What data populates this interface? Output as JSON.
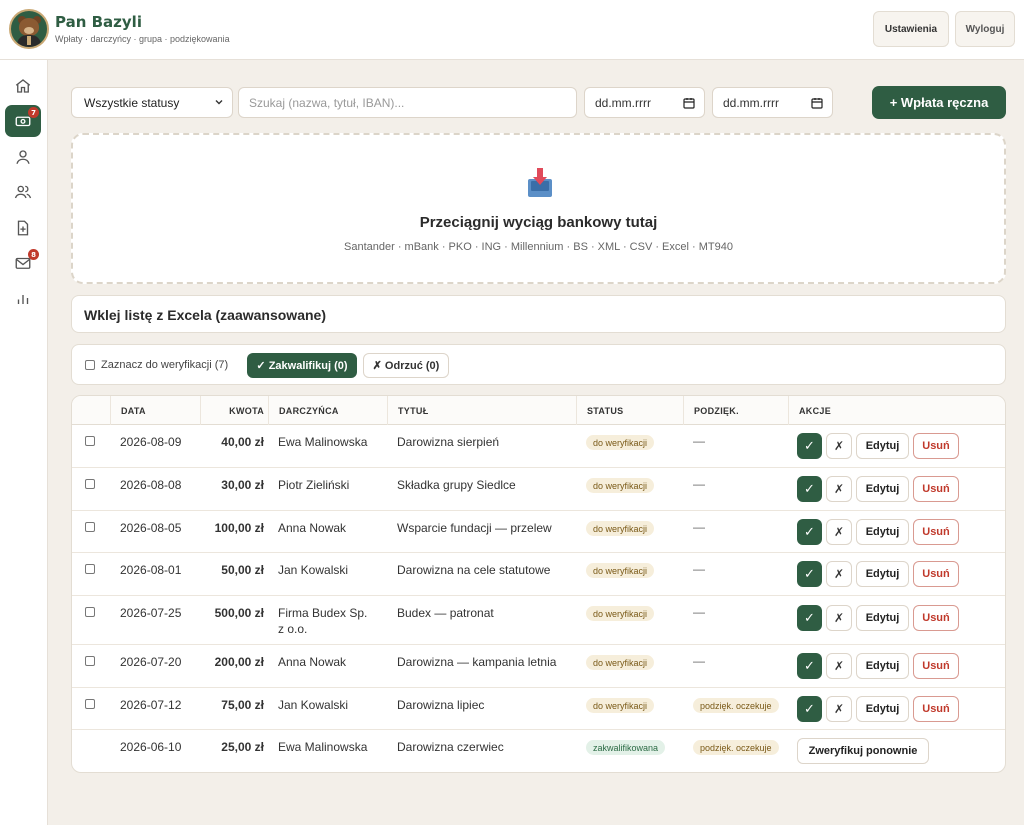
{
  "app": {
    "title": "Pan Bazyli",
    "subtitle": "Wpłaty · darczyńcy · grupa · podziękowania",
    "settings_label": "Ustawienia",
    "logout_label": "Wyloguj"
  },
  "sidebar": {
    "items": [
      {
        "icon": "home-icon",
        "active": false,
        "badge": ""
      },
      {
        "icon": "money-icon",
        "active": true,
        "badge": "7"
      },
      {
        "icon": "user-icon",
        "active": false,
        "badge": ""
      },
      {
        "icon": "users-icon",
        "active": false,
        "badge": ""
      },
      {
        "icon": "file-plus-icon",
        "active": false,
        "badge": ""
      },
      {
        "icon": "mail-icon",
        "active": false,
        "badge": "8"
      },
      {
        "icon": "chart-icon",
        "active": false,
        "badge": ""
      }
    ]
  },
  "filters": {
    "status_value": "Wszystkie statusy",
    "search_placeholder": "Szukaj (nazwa, tytuł, IBAN)...",
    "date_from": "dd.mm.rrrr",
    "date_to": "dd.mm.rrrr",
    "add_label": "+ Wpłata ręczna"
  },
  "dropzone": {
    "title": "Przeciągnij wyciąg bankowy tutaj",
    "formats": "Santander · mBank · PKO · ING · Millennium · BS · XML · CSV · Excel · MT940"
  },
  "paste": {
    "label": "Wklej listę z Excela (zaawansowane)"
  },
  "bulk": {
    "select_label": "Zaznacz do weryfikacji (7)",
    "qualify_label": "✓ Zakwalifikuj (0)",
    "reject_label": "✗ Odrzuć (0)"
  },
  "table": {
    "headers": [
      "DATA",
      "KWOTA",
      "DARCZYŃCA",
      "TYTUŁ",
      "STATUS",
      "PODZIĘK.",
      "AKCJE"
    ],
    "rows": [
      {
        "date": "2026-08-09",
        "amount": "40,00 zł",
        "donor": "Ewa Malinowska",
        "title": "Darowizna sierpień",
        "status": "do weryfikacji",
        "thanks": "—"
      },
      {
        "date": "2026-08-08",
        "amount": "30,00 zł",
        "donor": "Piotr Zieliński",
        "title": "Składka grupy Siedlce",
        "status": "do weryfikacji",
        "thanks": "—"
      },
      {
        "date": "2026-08-05",
        "amount": "100,00 zł",
        "donor": "Anna Nowak",
        "title": "Wsparcie fundacji — przelew",
        "status": "do weryfikacji",
        "thanks": "—"
      },
      {
        "date": "2026-08-01",
        "amount": "50,00 zł",
        "donor": "Jan Kowalski",
        "title": "Darowizna na cele statutowe",
        "status": "do weryfikacji",
        "thanks": "—"
      },
      {
        "date": "2026-07-25",
        "amount": "500,00 zł",
        "donor_line1": "Firma Budex Sp.",
        "donor_line2": "z o.o.",
        "title": "Budex — patronat",
        "status": "do weryfikacji",
        "thanks": "—"
      },
      {
        "date": "2026-07-20",
        "amount": "200,00 zł",
        "donor": "Anna Nowak",
        "title": "Darowizna — kampania letnia",
        "status": "do weryfikacji",
        "thanks": "—"
      },
      {
        "date": "2026-07-12",
        "amount": "75,00 zł",
        "donor": "Jan Kowalski",
        "title": "Darowizna lipiec",
        "status": "do weryfikacji",
        "thanks": "podzięk. oczekuje"
      },
      {
        "date": "2026-06-10",
        "amount": "25,00 zł",
        "donor": "Ewa Malinowska",
        "title": "Darowizna czerwiec",
        "status": "zakwalifikowana",
        "thanks": "podzięk. oczekuje"
      }
    ],
    "actions": {
      "approve": "✓",
      "reject": "✗",
      "edit": "Edytuj",
      "delete": "Usuń",
      "reverify": "Zweryfikuj ponownie"
    }
  },
  "colors": {
    "brand": "#2f5d43",
    "background": "#f3efe9",
    "danger": "#c0392b"
  }
}
